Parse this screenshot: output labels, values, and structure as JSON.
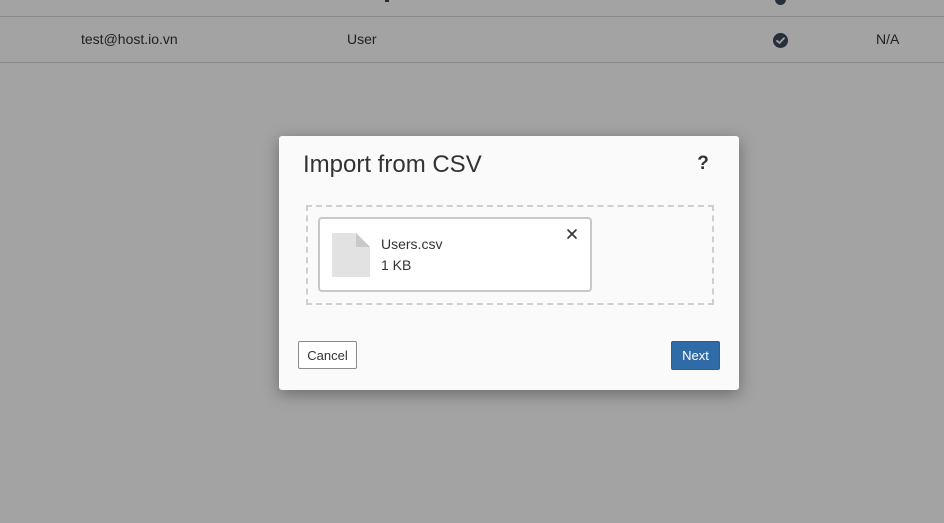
{
  "background_table": {
    "rows": [
      {
        "email": "test@host.io.vn",
        "role": "User",
        "status_icon": "check-circle-icon",
        "last_value": "N/A"
      }
    ]
  },
  "modal": {
    "title": "Import from CSV",
    "help_label": "?",
    "help_icon": "question-mark-icon",
    "file": {
      "name": "Users.csv",
      "size": "1 KB",
      "icon": "file-icon",
      "remove_icon": "close-icon"
    },
    "cancel_label": "Cancel",
    "next_label": "Next"
  },
  "colors": {
    "primary": "#2f6ba7",
    "overlay": "rgba(0,0,0,0.36)",
    "status_icon": "#3d4a5c"
  }
}
